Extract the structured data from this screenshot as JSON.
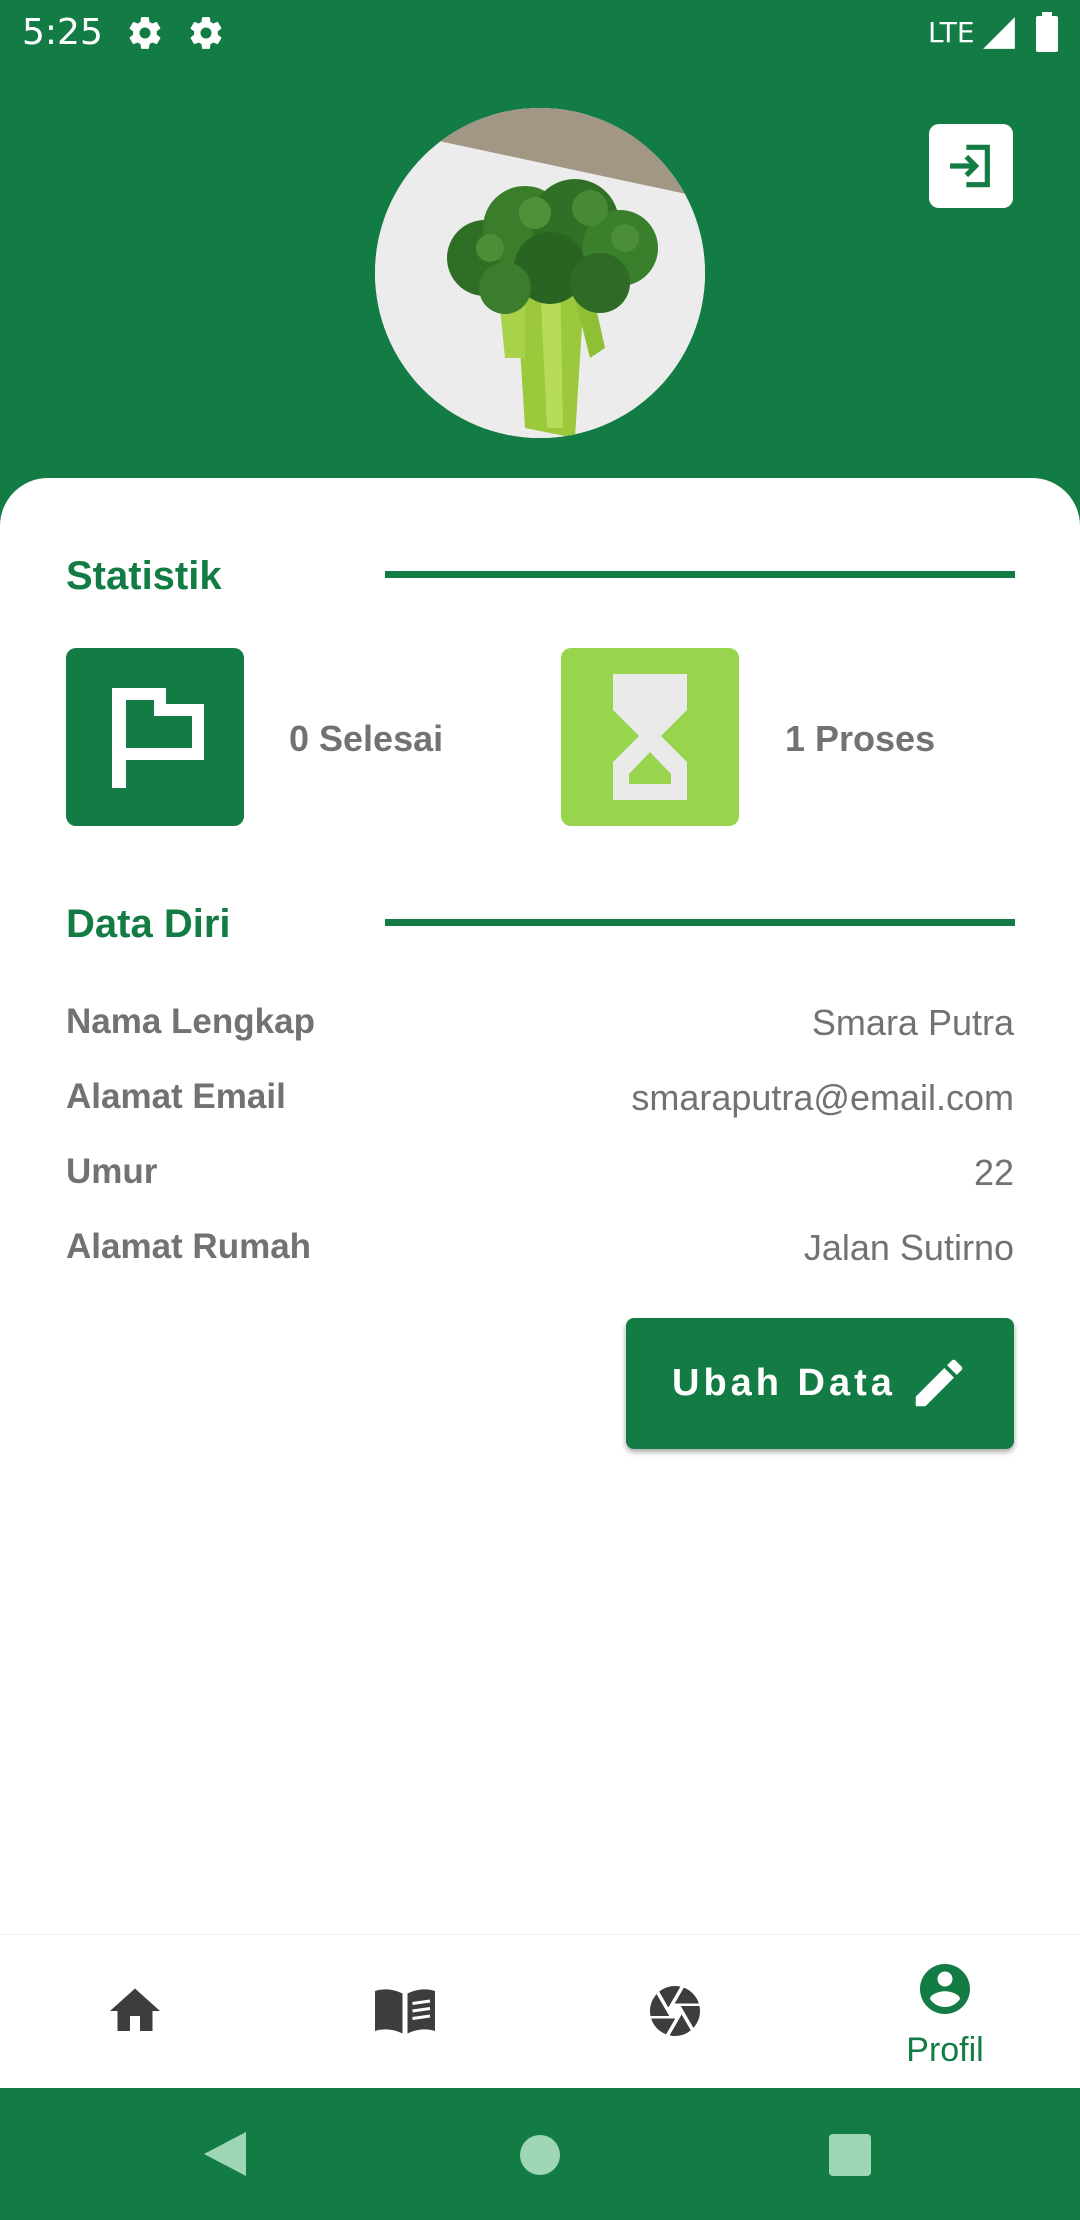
{
  "status_bar": {
    "time": "5:25",
    "network": "LTE"
  },
  "header": {
    "avatar_alt": "broccoli"
  },
  "stats": {
    "title": "Statistik",
    "done_label": "0 Selesai",
    "process_label": "1 Proses"
  },
  "personal": {
    "title": "Data Diri",
    "rows": [
      {
        "label": "Nama Lengkap",
        "value": "Smara Putra"
      },
      {
        "label": "Alamat Email",
        "value": "smaraputra@email.com"
      },
      {
        "label": "Umur",
        "value": "22"
      },
      {
        "label": "Alamat Rumah",
        "value": "Jalan Sutirno"
      }
    ],
    "edit_button": "Ubah Data"
  },
  "bottom_nav": {
    "items": [
      {
        "icon": "home-icon",
        "label": ""
      },
      {
        "icon": "book-icon",
        "label": ""
      },
      {
        "icon": "camera-shutter-icon",
        "label": ""
      },
      {
        "icon": "profile-icon",
        "label": "Profil"
      }
    ],
    "active": "Profil"
  },
  "colors": {
    "primary": "#137c45",
    "light_green": "#98d44e",
    "text_gray": "#727272"
  }
}
